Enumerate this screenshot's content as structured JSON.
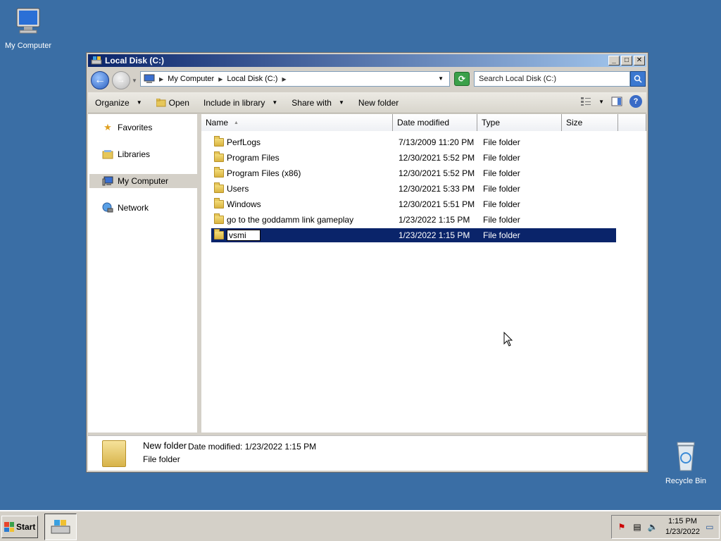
{
  "desktop": {
    "my_computer_label": "My Computer",
    "recycle_bin_label": "Recycle Bin"
  },
  "window": {
    "title": "Local Disk (C:)",
    "address": {
      "crumbs": [
        "My Computer",
        "Local Disk (C:)"
      ]
    },
    "search_placeholder": "Search Local Disk (C:)",
    "toolbar": {
      "organize": "Organize",
      "open": "Open",
      "include_in_library": "Include in library",
      "share_with": "Share with",
      "new_folder": "New folder"
    },
    "nav": {
      "favorites": "Favorites",
      "libraries": "Libraries",
      "my_computer": "My Computer",
      "network": "Network"
    },
    "columns": {
      "name": "Name",
      "date": "Date modified",
      "type": "Type",
      "size": "Size"
    },
    "rows": [
      {
        "name": "PerfLogs",
        "date": "7/13/2009 11:20 PM",
        "type": "File folder"
      },
      {
        "name": "Program Files",
        "date": "12/30/2021 5:52 PM",
        "type": "File folder"
      },
      {
        "name": "Program Files (x86)",
        "date": "12/30/2021 5:52 PM",
        "type": "File folder"
      },
      {
        "name": "Users",
        "date": "12/30/2021 5:33 PM",
        "type": "File folder"
      },
      {
        "name": "Windows",
        "date": "12/30/2021 5:51 PM",
        "type": "File folder"
      },
      {
        "name": "go to the goddamm link gameplay",
        "date": "1/23/2022 1:15 PM",
        "type": "File folder"
      },
      {
        "name": "vsmi",
        "date": "1/23/2022 1:15 PM",
        "type": "File folder"
      }
    ],
    "details": {
      "name": "New folder",
      "modified": "Date modified:  1/23/2022 1:15 PM",
      "type": "File folder"
    }
  },
  "taskbar": {
    "start_label": "Start",
    "clock_time": "1:15 PM",
    "clock_date": "1/23/2022"
  },
  "colors": {
    "desktop": "#3a6ea5",
    "selection": "#0a246a",
    "titlebar": "#0a246a"
  }
}
